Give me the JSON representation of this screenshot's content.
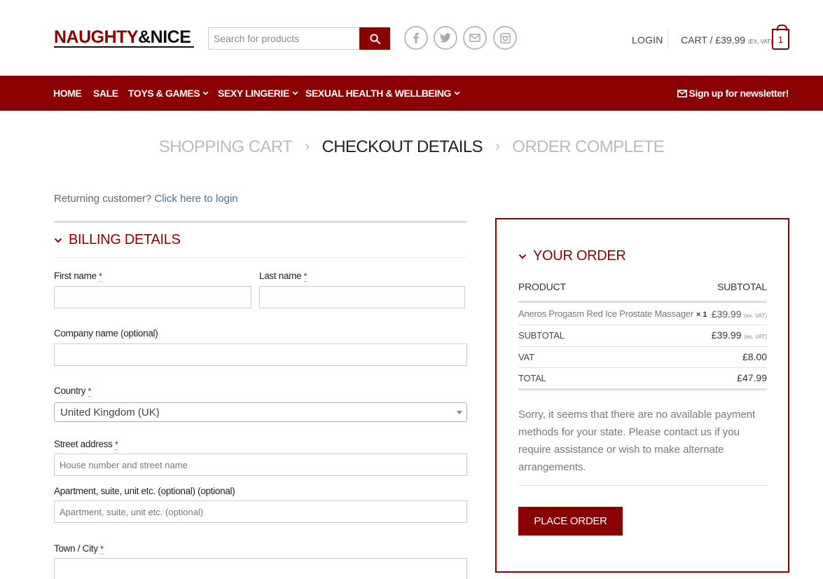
{
  "header": {
    "logo": {
      "part1": "NAUGHTY",
      "amp": "&",
      "part2": "NICE"
    },
    "search": {
      "placeholder": "Search for products"
    },
    "social_icons": [
      "facebook-icon",
      "twitter-icon",
      "email-icon",
      "instagram-icon"
    ],
    "login_label": "LOGIN",
    "cart": {
      "label": "CART / £39.99",
      "exvat": "(EX. VAT)",
      "count": "1"
    }
  },
  "nav": {
    "items": [
      {
        "label": "HOME",
        "dropdown": false
      },
      {
        "label": "SALE",
        "dropdown": false
      },
      {
        "label": "TOYS & GAMES",
        "dropdown": true
      },
      {
        "label": "SEXY LINGERIE",
        "dropdown": true
      },
      {
        "label": "SEXUAL HEALTH & WELLBEING",
        "dropdown": true
      }
    ],
    "newsletter_label": "Sign up for newsletter!"
  },
  "steps": {
    "cart": "SHOPPING CART",
    "checkout": "CHECKOUT DETAILS",
    "complete": "ORDER COMPLETE"
  },
  "returning": {
    "text": "Returning customer?",
    "link": "Click here to login"
  },
  "billing": {
    "title": "BILLING DETAILS",
    "first_name_label": "First name",
    "last_name_label": "Last name",
    "company_label": "Company name (optional)",
    "country_label": "Country",
    "country_value": "United Kingdom (UK)",
    "street_label": "Street address",
    "street_placeholder": "House number and street name",
    "apartment_label": "Apartment, suite, unit etc. (optional) (optional)",
    "apartment_placeholder": "Apartment, suite, unit etc. (optional)",
    "town_label": "Town / City",
    "required_marker": "*"
  },
  "order": {
    "title": "YOUR ORDER",
    "col_product": "PRODUCT",
    "col_subtotal": "SUBTOTAL",
    "item": {
      "name": "Aneros Progasm Red Ice Prostate Massager",
      "qty": "× 1",
      "price": "£39.99",
      "exvat": "(ex. VAT)"
    },
    "subtotal_label": "SUBTOTAL",
    "subtotal_value": "£39.99",
    "subtotal_exvat": "(ex. VAT)",
    "vat_label": "VAT",
    "vat_value": "£8.00",
    "total_label": "TOTAL",
    "total_value": "£47.99",
    "notice": "Sorry, it seems that there are no available payment methods for your state. Please contact us if you require assistance or wish to make alternate arrangements.",
    "place_order_label": "PLACE ORDER"
  },
  "colors": {
    "brand": "#8b0000",
    "muted_step": "#bbbbbb",
    "link": "#4a6f8f"
  }
}
